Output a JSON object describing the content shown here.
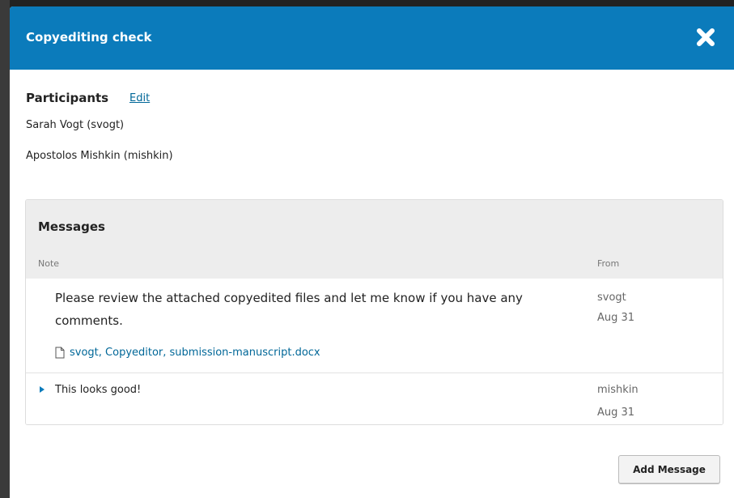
{
  "modal": {
    "title": "Copyediting check",
    "close_icon": "close-icon",
    "header_color": "#0b7bbb"
  },
  "participants": {
    "heading": "Participants",
    "edit_label": "Edit",
    "people": [
      "Sarah Vogt (svogt)",
      "Apostolos Mishkin (mishkin)"
    ]
  },
  "messages": {
    "title": "Messages",
    "columns": {
      "note": "Note",
      "from": "From"
    },
    "rows": [
      {
        "note": "Please review the attached copyedited files and let me know if you have any comments.",
        "attachment": "svogt, Copyeditor, submission-manuscript.docx",
        "attachment_icon": "file-icon",
        "from_user": "svogt",
        "from_date": "Aug 31"
      },
      {
        "note": "This looks good!",
        "expand_icon": "expand-arrow-icon",
        "from_user": "mishkin",
        "from_date": "Aug 31"
      }
    ]
  },
  "actions": {
    "add_message_label": "Add Message"
  },
  "colors": {
    "link": "#006798",
    "panel_header": "#ededed"
  }
}
